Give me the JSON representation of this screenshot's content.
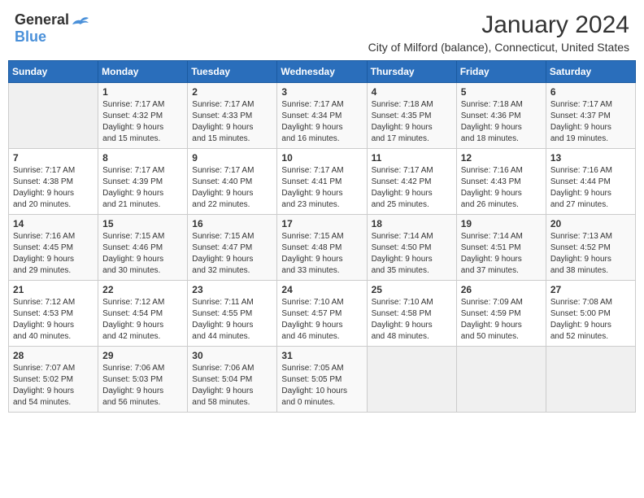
{
  "header": {
    "logo_general": "General",
    "logo_blue": "Blue",
    "month_title": "January 2024",
    "subtitle": "City of Milford (balance), Connecticut, United States"
  },
  "weekdays": [
    "Sunday",
    "Monday",
    "Tuesday",
    "Wednesday",
    "Thursday",
    "Friday",
    "Saturday"
  ],
  "weeks": [
    [
      {
        "day": "",
        "info": ""
      },
      {
        "day": "1",
        "info": "Sunrise: 7:17 AM\nSunset: 4:32 PM\nDaylight: 9 hours\nand 15 minutes."
      },
      {
        "day": "2",
        "info": "Sunrise: 7:17 AM\nSunset: 4:33 PM\nDaylight: 9 hours\nand 15 minutes."
      },
      {
        "day": "3",
        "info": "Sunrise: 7:17 AM\nSunset: 4:34 PM\nDaylight: 9 hours\nand 16 minutes."
      },
      {
        "day": "4",
        "info": "Sunrise: 7:18 AM\nSunset: 4:35 PM\nDaylight: 9 hours\nand 17 minutes."
      },
      {
        "day": "5",
        "info": "Sunrise: 7:18 AM\nSunset: 4:36 PM\nDaylight: 9 hours\nand 18 minutes."
      },
      {
        "day": "6",
        "info": "Sunrise: 7:17 AM\nSunset: 4:37 PM\nDaylight: 9 hours\nand 19 minutes."
      }
    ],
    [
      {
        "day": "7",
        "info": "Sunrise: 7:17 AM\nSunset: 4:38 PM\nDaylight: 9 hours\nand 20 minutes."
      },
      {
        "day": "8",
        "info": "Sunrise: 7:17 AM\nSunset: 4:39 PM\nDaylight: 9 hours\nand 21 minutes."
      },
      {
        "day": "9",
        "info": "Sunrise: 7:17 AM\nSunset: 4:40 PM\nDaylight: 9 hours\nand 22 minutes."
      },
      {
        "day": "10",
        "info": "Sunrise: 7:17 AM\nSunset: 4:41 PM\nDaylight: 9 hours\nand 23 minutes."
      },
      {
        "day": "11",
        "info": "Sunrise: 7:17 AM\nSunset: 4:42 PM\nDaylight: 9 hours\nand 25 minutes."
      },
      {
        "day": "12",
        "info": "Sunrise: 7:16 AM\nSunset: 4:43 PM\nDaylight: 9 hours\nand 26 minutes."
      },
      {
        "day": "13",
        "info": "Sunrise: 7:16 AM\nSunset: 4:44 PM\nDaylight: 9 hours\nand 27 minutes."
      }
    ],
    [
      {
        "day": "14",
        "info": "Sunrise: 7:16 AM\nSunset: 4:45 PM\nDaylight: 9 hours\nand 29 minutes."
      },
      {
        "day": "15",
        "info": "Sunrise: 7:15 AM\nSunset: 4:46 PM\nDaylight: 9 hours\nand 30 minutes."
      },
      {
        "day": "16",
        "info": "Sunrise: 7:15 AM\nSunset: 4:47 PM\nDaylight: 9 hours\nand 32 minutes."
      },
      {
        "day": "17",
        "info": "Sunrise: 7:15 AM\nSunset: 4:48 PM\nDaylight: 9 hours\nand 33 minutes."
      },
      {
        "day": "18",
        "info": "Sunrise: 7:14 AM\nSunset: 4:50 PM\nDaylight: 9 hours\nand 35 minutes."
      },
      {
        "day": "19",
        "info": "Sunrise: 7:14 AM\nSunset: 4:51 PM\nDaylight: 9 hours\nand 37 minutes."
      },
      {
        "day": "20",
        "info": "Sunrise: 7:13 AM\nSunset: 4:52 PM\nDaylight: 9 hours\nand 38 minutes."
      }
    ],
    [
      {
        "day": "21",
        "info": "Sunrise: 7:12 AM\nSunset: 4:53 PM\nDaylight: 9 hours\nand 40 minutes."
      },
      {
        "day": "22",
        "info": "Sunrise: 7:12 AM\nSunset: 4:54 PM\nDaylight: 9 hours\nand 42 minutes."
      },
      {
        "day": "23",
        "info": "Sunrise: 7:11 AM\nSunset: 4:55 PM\nDaylight: 9 hours\nand 44 minutes."
      },
      {
        "day": "24",
        "info": "Sunrise: 7:10 AM\nSunset: 4:57 PM\nDaylight: 9 hours\nand 46 minutes."
      },
      {
        "day": "25",
        "info": "Sunrise: 7:10 AM\nSunset: 4:58 PM\nDaylight: 9 hours\nand 48 minutes."
      },
      {
        "day": "26",
        "info": "Sunrise: 7:09 AM\nSunset: 4:59 PM\nDaylight: 9 hours\nand 50 minutes."
      },
      {
        "day": "27",
        "info": "Sunrise: 7:08 AM\nSunset: 5:00 PM\nDaylight: 9 hours\nand 52 minutes."
      }
    ],
    [
      {
        "day": "28",
        "info": "Sunrise: 7:07 AM\nSunset: 5:02 PM\nDaylight: 9 hours\nand 54 minutes."
      },
      {
        "day": "29",
        "info": "Sunrise: 7:06 AM\nSunset: 5:03 PM\nDaylight: 9 hours\nand 56 minutes."
      },
      {
        "day": "30",
        "info": "Sunrise: 7:06 AM\nSunset: 5:04 PM\nDaylight: 9 hours\nand 58 minutes."
      },
      {
        "day": "31",
        "info": "Sunrise: 7:05 AM\nSunset: 5:05 PM\nDaylight: 10 hours\nand 0 minutes."
      },
      {
        "day": "",
        "info": ""
      },
      {
        "day": "",
        "info": ""
      },
      {
        "day": "",
        "info": ""
      }
    ]
  ]
}
